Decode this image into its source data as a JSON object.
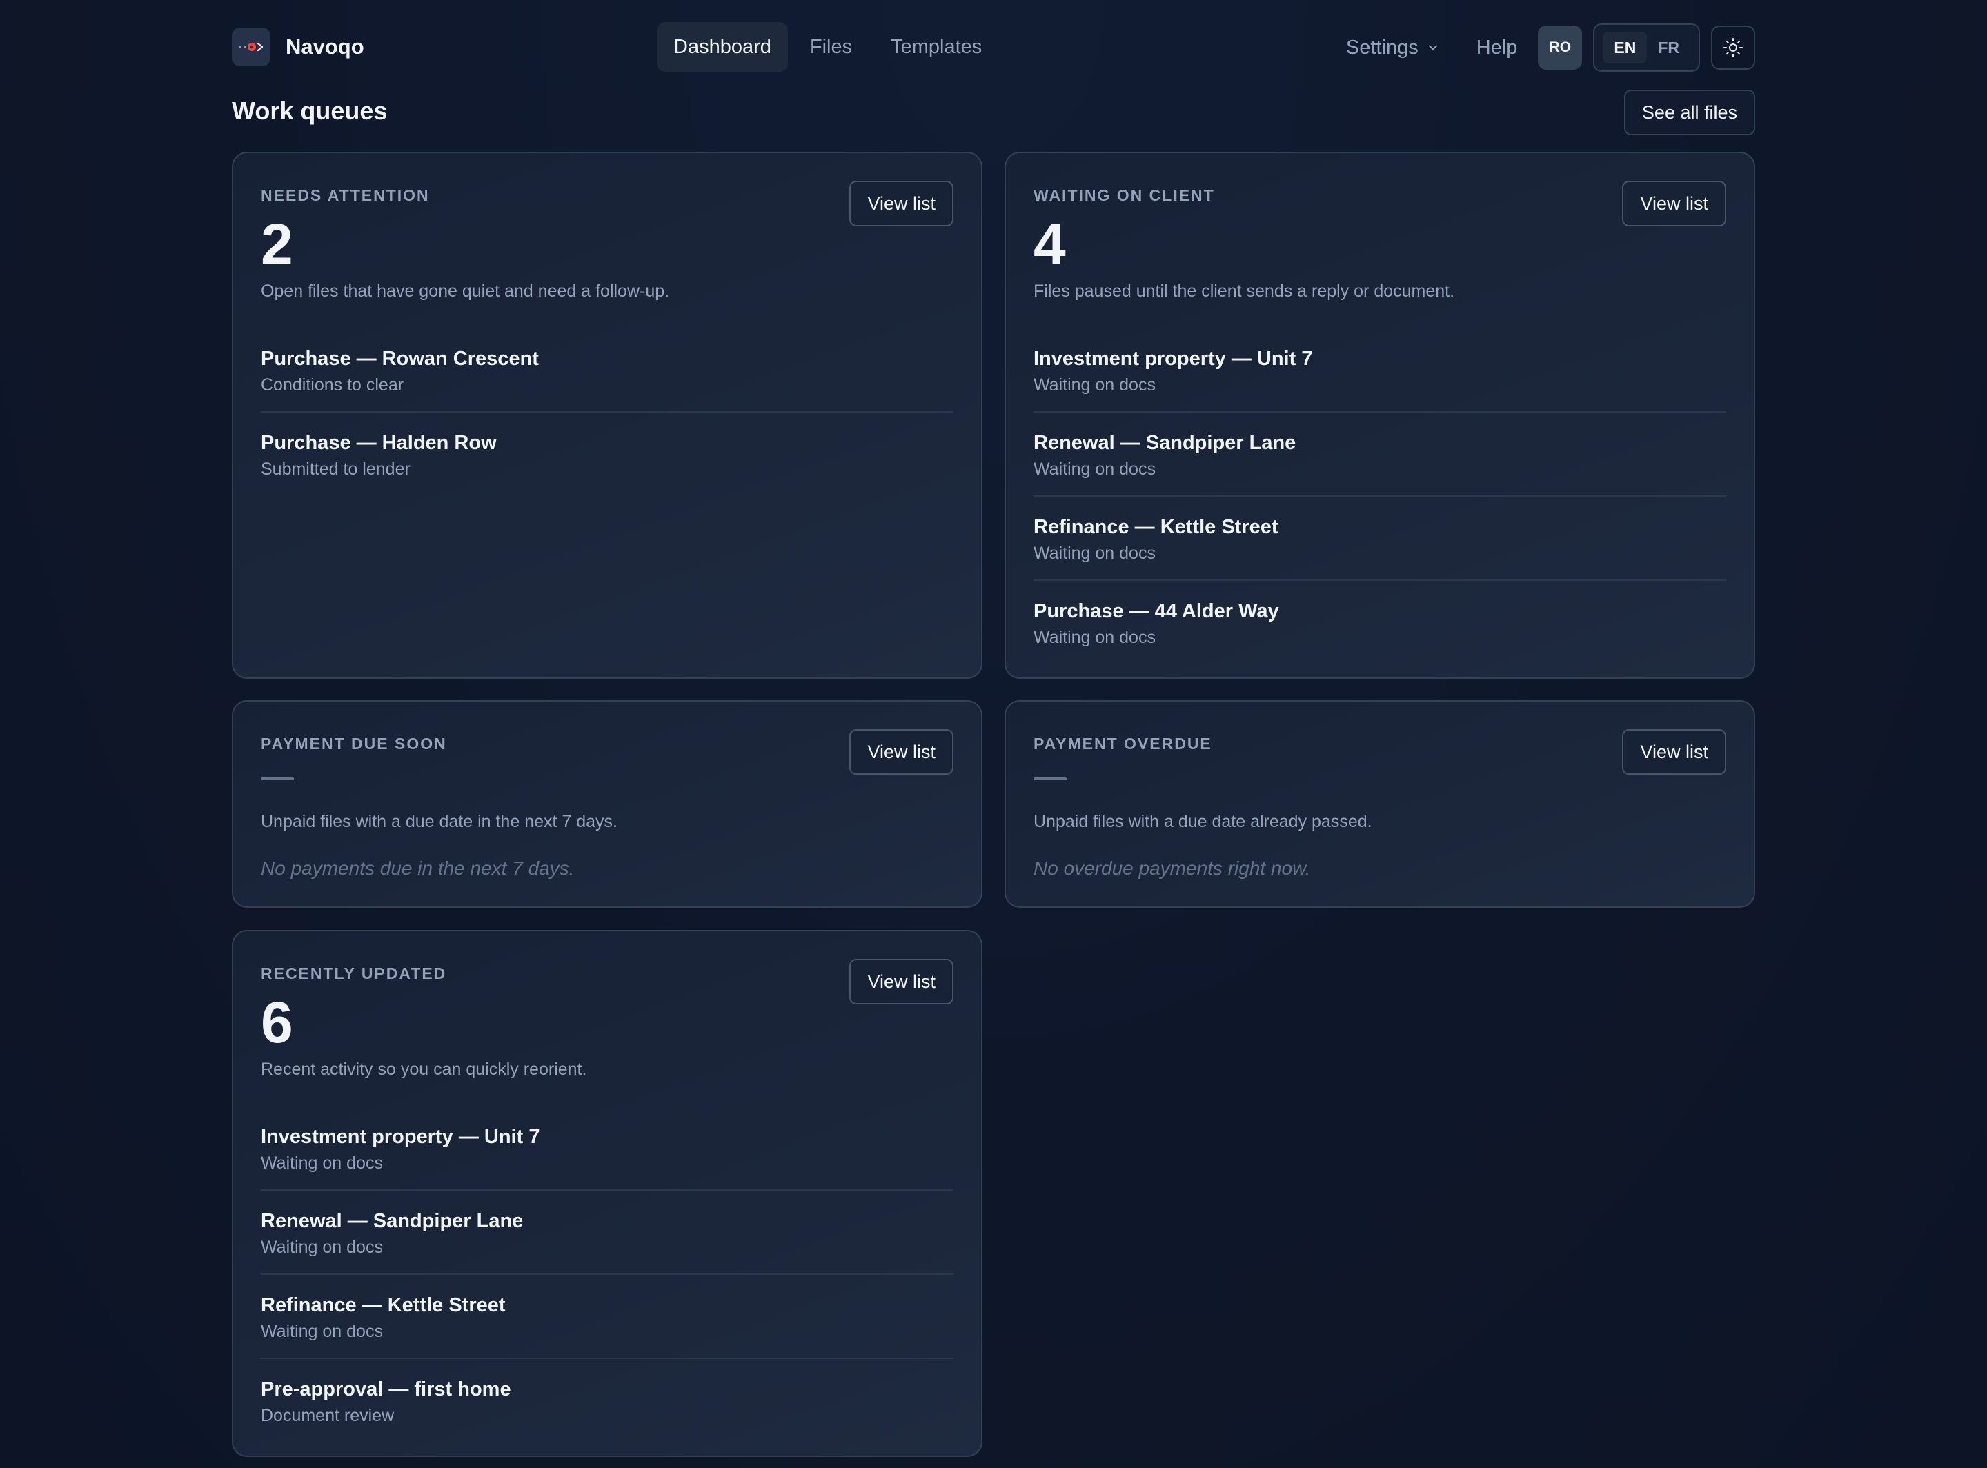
{
  "app": {
    "name": "Navoqo",
    "logo_icon": "brand-logo-icon"
  },
  "nav": {
    "items": [
      {
        "label": "Dashboard",
        "active": true
      },
      {
        "label": "Files",
        "active": false
      },
      {
        "label": "Templates",
        "active": false
      }
    ]
  },
  "header": {
    "settings_label": "Settings",
    "help_label": "Help",
    "avatar_initials": "RO",
    "languages": [
      {
        "code": "EN",
        "active": true
      },
      {
        "code": "FR",
        "active": false
      }
    ],
    "theme_icon": "sun-icon"
  },
  "section": {
    "title": "Work queues",
    "see_all_label": "See all files"
  },
  "cards": {
    "needs_attention": {
      "label": "NEEDS ATTENTION",
      "count": "2",
      "description": "Open files that have gone quiet and need a follow-up.",
      "button": "View list",
      "items": [
        {
          "title": "Purchase — Rowan Crescent",
          "status": "Conditions to clear"
        },
        {
          "title": "Purchase — Halden Row",
          "status": "Submitted to lender"
        }
      ]
    },
    "waiting_on_client": {
      "label": "WAITING ON CLIENT",
      "count": "4",
      "description": "Files paused until the client sends a reply or document.",
      "button": "View list",
      "items": [
        {
          "title": "Investment property — Unit 7",
          "status": "Waiting on docs"
        },
        {
          "title": "Renewal — Sandpiper Lane",
          "status": "Waiting on docs"
        },
        {
          "title": "Refinance — Kettle Street",
          "status": "Waiting on docs"
        },
        {
          "title": "Purchase — 44 Alder Way",
          "status": "Waiting on docs"
        }
      ]
    },
    "payment_due_soon": {
      "label": "PAYMENT DUE SOON",
      "description": "Unpaid files with a due date in the next 7 days.",
      "empty": "No payments due in the next 7 days.",
      "button": "View list"
    },
    "payment_overdue": {
      "label": "PAYMENT OVERDUE",
      "description": "Unpaid files with a due date already passed.",
      "empty": "No overdue payments right now.",
      "button": "View list"
    },
    "recently_updated": {
      "label": "RECENTLY UPDATED",
      "count": "6",
      "description": "Recent activity so you can quickly reorient.",
      "button": "View list",
      "items": [
        {
          "title": "Investment property — Unit 7",
          "status": "Waiting on docs"
        },
        {
          "title": "Renewal — Sandpiper Lane",
          "status": "Waiting on docs"
        },
        {
          "title": "Refinance — Kettle Street",
          "status": "Waiting on docs"
        },
        {
          "title": "Pre-approval — first home",
          "status": "Document review"
        }
      ]
    }
  },
  "colors": {
    "background": "#0f172a",
    "card": "#1b263b",
    "border": "#334155",
    "text": "#f1f5f9",
    "muted": "#94a3b8",
    "logo_accent": "#ef4444"
  }
}
